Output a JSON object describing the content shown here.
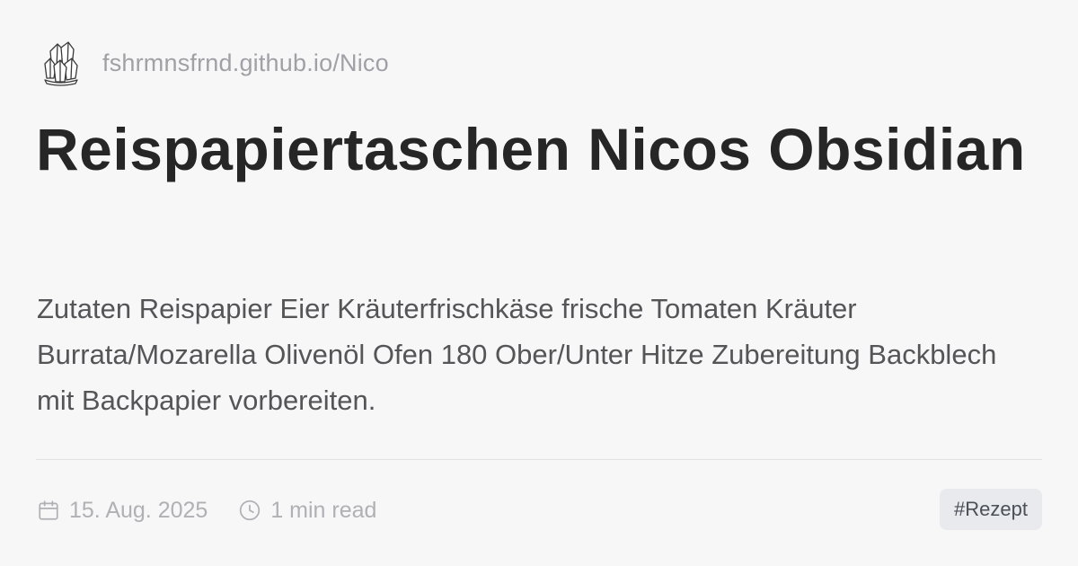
{
  "site": {
    "url": "fshrmnsfrnd.github.io/Nico",
    "logo_icon": "crystal-cluster-icon"
  },
  "post": {
    "title": "Reispapiertaschen Nicos Obsidian",
    "description": "Zutaten Reispapier Eier Kräuterfrischkäse frische Tomaten Kräuter Burrata/Mozarella Olivenöl Ofen 180 Ober/Unter Hitze Zubereitung Backblech mit Backpapier vorbereiten.",
    "date": "15. Aug. 2025",
    "date_icon": "calendar-icon",
    "reading_time": "1 min read",
    "reading_time_icon": "clock-icon",
    "tag": "#Rezept"
  },
  "colors": {
    "background": "#f7f7f8",
    "title": "#262626",
    "description": "#555558",
    "muted": "#a0a0a6",
    "tag_background": "#e8eaed"
  }
}
